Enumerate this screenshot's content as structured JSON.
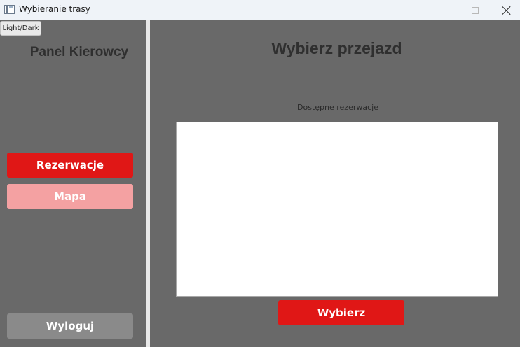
{
  "window": {
    "title": "Wybieranie trasy",
    "icon": "app-window-icon",
    "controls": [
      "minimize-icon",
      "maximize-icon",
      "close-icon"
    ]
  },
  "theme_toggle": {
    "label": "Light/Dark"
  },
  "sidebar": {
    "title": "Panel Kierowcy",
    "buttons": [
      {
        "label": "Rezerwacje",
        "color": "#e01716"
      },
      {
        "label": "Mapa",
        "color": "#f4a1a2"
      }
    ],
    "logout": {
      "label": "Wyloguj",
      "color": "#8a8a8a"
    }
  },
  "main": {
    "title": "Wybierz przejazd",
    "list_label": "Dostępne rezerwacje",
    "reservations": [],
    "choose_button": {
      "label": "Wybierz",
      "color": "#e01716"
    }
  },
  "colors": {
    "background": "#696969",
    "accent": "#e01716",
    "divider": "#e8e8e8"
  }
}
